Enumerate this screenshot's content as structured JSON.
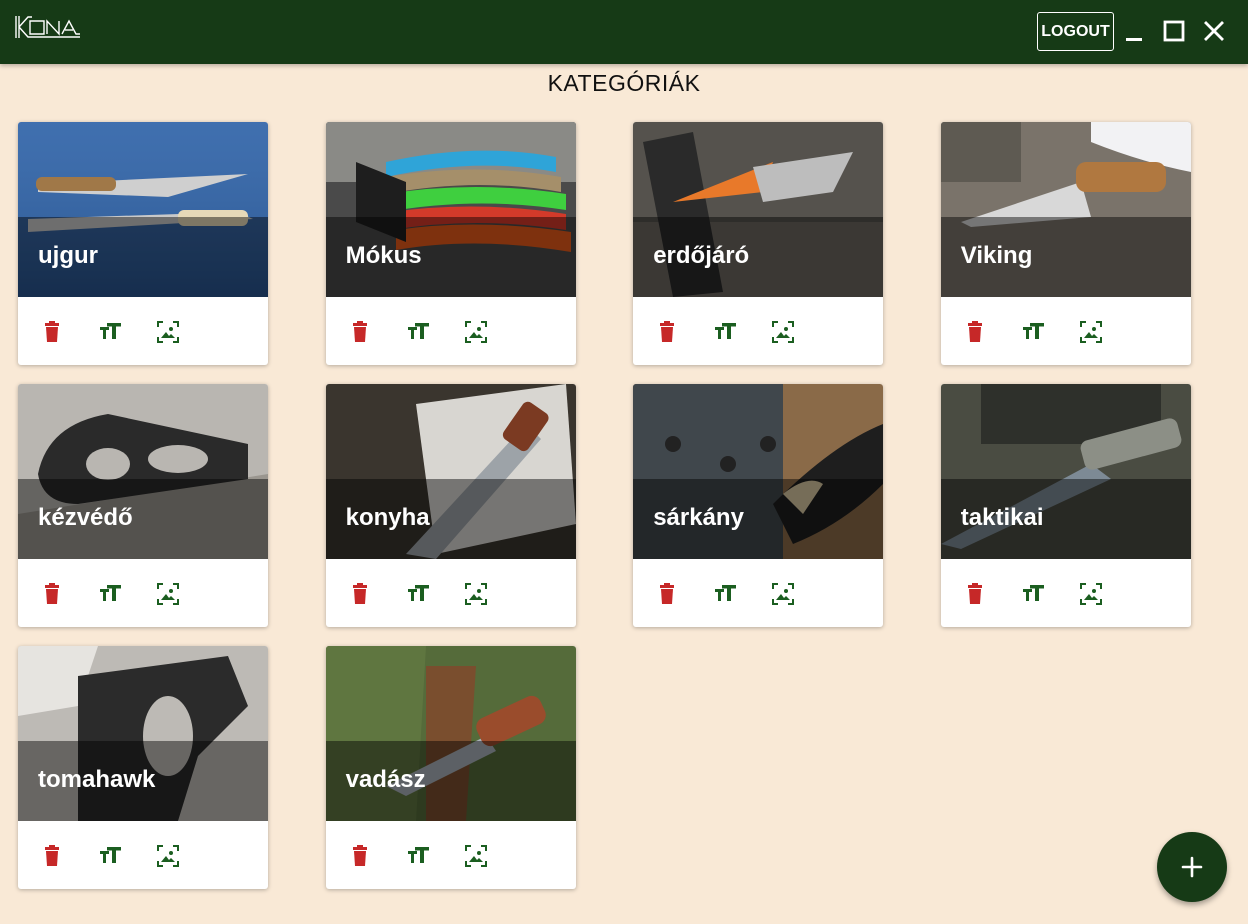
{
  "app": {
    "logo_text": "KONA",
    "logout_label": "LOGOUT"
  },
  "page": {
    "title": "KATEGÓRIÁK"
  },
  "categories": [
    {
      "label": "ujgur"
    },
    {
      "label": "Mókus"
    },
    {
      "label": "erdőjáró"
    },
    {
      "label": "Viking"
    },
    {
      "label": "kézvédő"
    },
    {
      "label": "konyha"
    },
    {
      "label": "sárkány"
    },
    {
      "label": "taktikai"
    },
    {
      "label": "tomahawk"
    },
    {
      "label": "vadász"
    }
  ],
  "colors": {
    "header_bg": "#163a16",
    "page_bg": "#f9e9d6",
    "delete_icon": "#c62828",
    "action_icon": "#1b5e20"
  },
  "icons": {
    "window_controls": [
      "minimize-icon",
      "maximize-icon",
      "close-icon"
    ],
    "card_actions": [
      "delete-icon",
      "text-fields-icon",
      "image-icon"
    ],
    "fab": "plus-icon"
  }
}
